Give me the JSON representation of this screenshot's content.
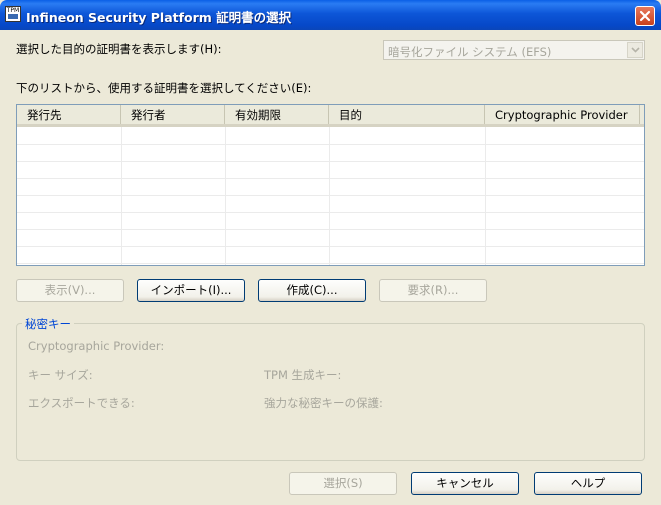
{
  "window": {
    "title": "Infineon Security Platform 証明書の選択",
    "icon_label": "TPM"
  },
  "purpose": {
    "label": "選択した目的の証明書を表示します(H):",
    "selected": "暗号化ファイル システム (EFS)"
  },
  "list": {
    "label": "下のリストから、使用する証明書を選択してください(E):",
    "columns": [
      "発行先",
      "発行者",
      "有効期限",
      "目的",
      "Cryptographic Provider"
    ],
    "rows": []
  },
  "buttons": {
    "view": "表示(V)...",
    "import": "インポート(I)...",
    "create": "作成(C)...",
    "request": "要求(R)...",
    "select": "選択(S)",
    "cancel": "キャンセル",
    "help": "ヘルプ"
  },
  "private_key": {
    "title": "秘密キー",
    "provider_label": "Cryptographic Provider:",
    "key_size_label": "キー サイズ:",
    "tpm_key_label": "TPM 生成キー:",
    "exportable_label": "エクスポートできる:",
    "strong_protection_label": "強力な秘密キーの保護:"
  },
  "colors": {
    "title_bar": "#0a5fe6",
    "dialog_bg": "#ece9d8",
    "group_title": "#0046d5",
    "disabled_text": "#a7a69c"
  }
}
